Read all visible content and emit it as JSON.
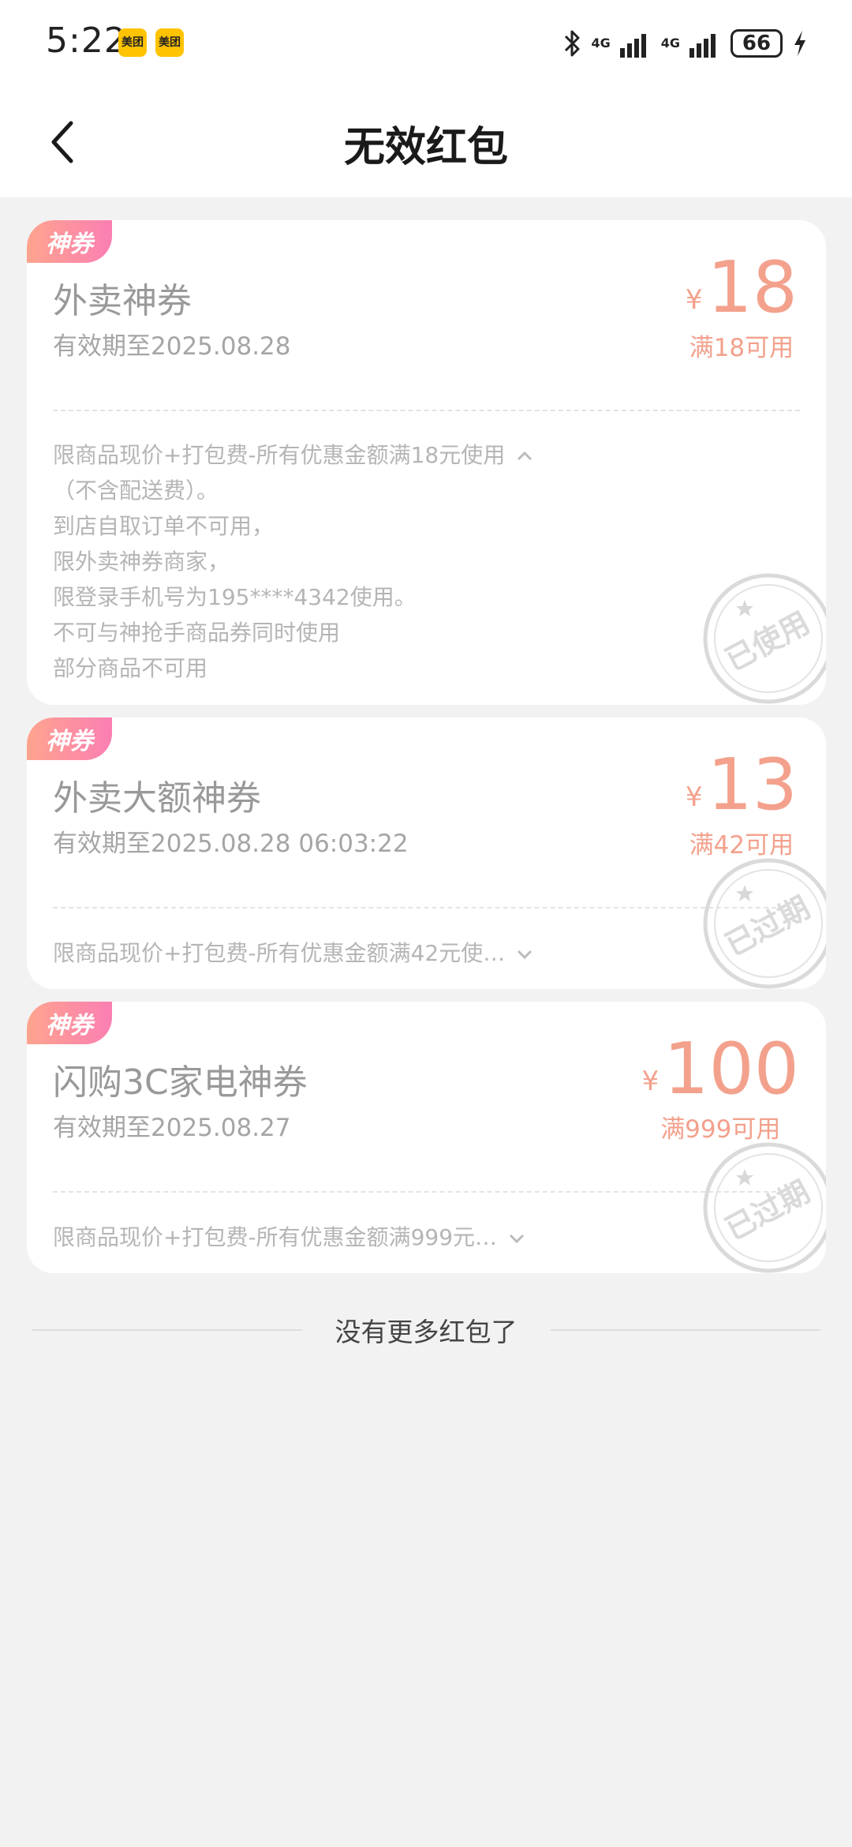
{
  "status_bar": {
    "time": "5:22",
    "app_badges": [
      "美团",
      "美团"
    ],
    "network_labels": [
      "4G",
      "4G"
    ],
    "battery_level": "66",
    "icons": [
      "bluetooth-icon",
      "signal-icon",
      "charging-icon"
    ]
  },
  "header": {
    "title": "无效红包",
    "back_icon": "chevron-left-icon"
  },
  "coupons": [
    {
      "tag": "神券",
      "title": "外卖神券",
      "expiry": "有效期至2025.08.28",
      "currency": "¥",
      "amount": "18",
      "condition": "满18可用",
      "rules": [
        "限商品现价+打包费-所有优惠金额满18元使用",
        "（不含配送费）。",
        "到店自取订单不可用，",
        "限外卖神券商家，",
        "限登录手机号为195****4342使用。",
        "不可与神抢手商品券同时使用",
        "部分商品不可用"
      ],
      "expanded": true,
      "stamp": "已使用"
    },
    {
      "tag": "神券",
      "title": "外卖大额神券",
      "expiry": "有效期至2025.08.28 06:03:22",
      "currency": "¥",
      "amount": "13",
      "condition": "满42可用",
      "rules": [
        "限商品现价+打包费-所有优惠金额满42元使…"
      ],
      "expanded": false,
      "stamp": "已过期"
    },
    {
      "tag": "神券",
      "title": "闪购3C家电神券",
      "expiry": "有效期至2025.08.27",
      "currency": "¥",
      "amount": "100",
      "condition": "满999可用",
      "rules": [
        "限商品现价+打包费-所有优惠金额满999元…"
      ],
      "expanded": false,
      "stamp": "已过期"
    }
  ],
  "footer": {
    "end_text": "没有更多红包了"
  },
  "colors": {
    "accent_amount": "#f3a18c",
    "tag_gradient_start": "#fea48e",
    "tag_gradient_end": "#fb7fb3",
    "page_background": "#f2f2f3"
  }
}
